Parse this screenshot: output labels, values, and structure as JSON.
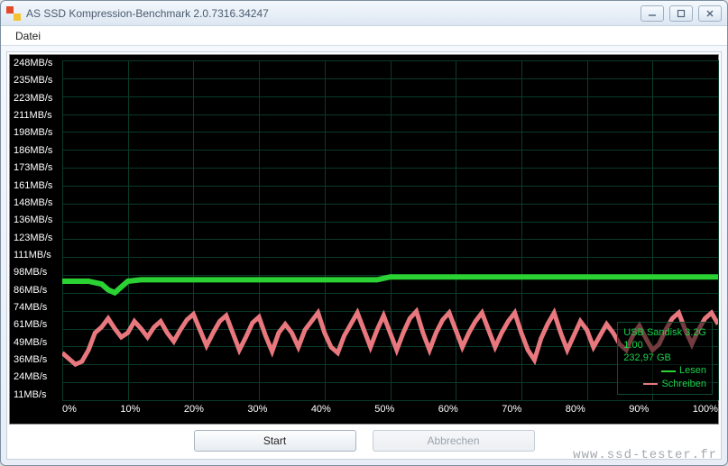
{
  "window": {
    "title": "AS SSD Kompression-Benchmark 2.0.7316.34247"
  },
  "menu": {
    "file": "Datei"
  },
  "chart_data": {
    "type": "line",
    "xlabel": "",
    "ylabel": "",
    "xlim": [
      0,
      100
    ],
    "ylim": [
      0,
      248
    ],
    "x_ticks": [
      "0%",
      "10%",
      "20%",
      "30%",
      "40%",
      "50%",
      "60%",
      "70%",
      "80%",
      "90%",
      "100%"
    ],
    "y_ticks": [
      "248MB/s",
      "235MB/s",
      "223MB/s",
      "211MB/s",
      "198MB/s",
      "186MB/s",
      "173MB/s",
      "161MB/s",
      "148MB/s",
      "136MB/s",
      "123MB/s",
      "111MB/s",
      "98MB/s",
      "86MB/s",
      "74MB/s",
      "61MB/s",
      "49MB/s",
      "36MB/s",
      "24MB/s",
      "11MB/s"
    ],
    "series": [
      {
        "name": "Lesen",
        "color": "#2bd233",
        "values": [
          [
            0,
            94
          ],
          [
            2,
            94
          ],
          [
            4,
            94
          ],
          [
            6,
            92
          ],
          [
            7,
            88
          ],
          [
            8,
            86
          ],
          [
            9,
            90
          ],
          [
            10,
            94
          ],
          [
            12,
            95
          ],
          [
            15,
            95
          ],
          [
            18,
            95
          ],
          [
            22,
            95
          ],
          [
            26,
            95
          ],
          [
            30,
            95
          ],
          [
            35,
            95
          ],
          [
            40,
            95
          ],
          [
            45,
            95
          ],
          [
            48,
            95
          ],
          [
            50,
            97
          ],
          [
            55,
            97
          ],
          [
            60,
            97
          ],
          [
            65,
            97
          ],
          [
            70,
            97
          ],
          [
            75,
            97
          ],
          [
            80,
            97
          ],
          [
            85,
            97
          ],
          [
            90,
            97
          ],
          [
            95,
            97
          ],
          [
            100,
            97
          ]
        ]
      },
      {
        "name": "Schreiben",
        "color": "#e8787e",
        "values": [
          [
            0,
            44
          ],
          [
            1,
            40
          ],
          [
            2,
            36
          ],
          [
            3,
            38
          ],
          [
            4,
            46
          ],
          [
            5,
            58
          ],
          [
            6,
            62
          ],
          [
            7,
            68
          ],
          [
            8,
            61
          ],
          [
            9,
            55
          ],
          [
            10,
            58
          ],
          [
            11,
            66
          ],
          [
            12,
            61
          ],
          [
            13,
            55
          ],
          [
            14,
            62
          ],
          [
            15,
            66
          ],
          [
            16,
            58
          ],
          [
            17,
            52
          ],
          [
            18,
            60
          ],
          [
            19,
            67
          ],
          [
            20,
            71
          ],
          [
            21,
            60
          ],
          [
            22,
            49
          ],
          [
            23,
            58
          ],
          [
            24,
            66
          ],
          [
            25,
            70
          ],
          [
            26,
            58
          ],
          [
            27,
            46
          ],
          [
            28,
            55
          ],
          [
            29,
            65
          ],
          [
            30,
            69
          ],
          [
            31,
            56
          ],
          [
            32,
            45
          ],
          [
            33,
            58
          ],
          [
            34,
            64
          ],
          [
            35,
            58
          ],
          [
            36,
            48
          ],
          [
            37,
            60
          ],
          [
            38,
            66
          ],
          [
            39,
            72
          ],
          [
            40,
            58
          ],
          [
            41,
            48
          ],
          [
            42,
            44
          ],
          [
            43,
            56
          ],
          [
            44,
            64
          ],
          [
            45,
            72
          ],
          [
            46,
            60
          ],
          [
            47,
            48
          ],
          [
            48,
            60
          ],
          [
            49,
            70
          ],
          [
            50,
            58
          ],
          [
            51,
            46
          ],
          [
            52,
            58
          ],
          [
            53,
            68
          ],
          [
            54,
            73
          ],
          [
            55,
            58
          ],
          [
            56,
            46
          ],
          [
            57,
            58
          ],
          [
            58,
            67
          ],
          [
            59,
            72
          ],
          [
            60,
            60
          ],
          [
            61,
            48
          ],
          [
            62,
            58
          ],
          [
            63,
            66
          ],
          [
            64,
            72
          ],
          [
            65,
            60
          ],
          [
            66,
            48
          ],
          [
            67,
            58
          ],
          [
            68,
            66
          ],
          [
            69,
            72
          ],
          [
            70,
            58
          ],
          [
            71,
            46
          ],
          [
            72,
            39
          ],
          [
            73,
            54
          ],
          [
            74,
            64
          ],
          [
            75,
            72
          ],
          [
            76,
            58
          ],
          [
            77,
            46
          ],
          [
            78,
            56
          ],
          [
            79,
            66
          ],
          [
            80,
            60
          ],
          [
            81,
            48
          ],
          [
            82,
            56
          ],
          [
            83,
            64
          ],
          [
            84,
            58
          ],
          [
            85,
            50
          ],
          [
            86,
            46
          ],
          [
            87,
            56
          ],
          [
            88,
            63
          ],
          [
            89,
            54
          ],
          [
            90,
            46
          ],
          [
            91,
            50
          ],
          [
            92,
            60
          ],
          [
            93,
            68
          ],
          [
            94,
            72
          ],
          [
            95,
            60
          ],
          [
            96,
            50
          ],
          [
            97,
            60
          ],
          [
            98,
            68
          ],
          [
            99,
            72
          ],
          [
            100,
            64
          ]
        ]
      }
    ]
  },
  "legend": {
    "device": "USB Sandisk 3.2G",
    "firmware": "1.00",
    "capacity": "232,97 GB",
    "read": "Lesen",
    "write": "Schreiben",
    "read_color": "#2bd233",
    "write_color": "#e8787e"
  },
  "buttons": {
    "start": "Start",
    "cancel": "Abbrechen"
  },
  "watermark": "www.ssd-tester.fr"
}
